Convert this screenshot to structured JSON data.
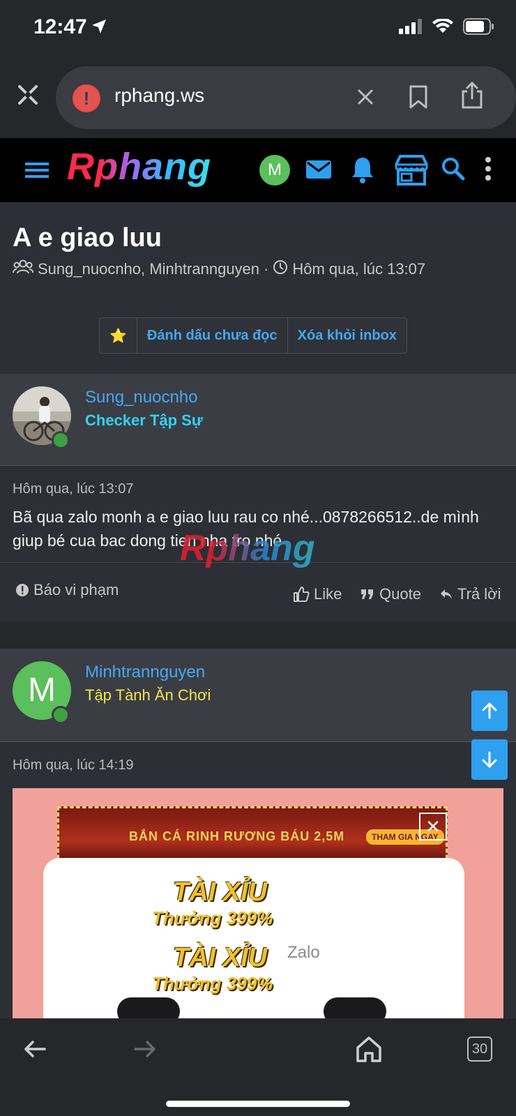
{
  "status_bar": {
    "time": "12:47"
  },
  "browser": {
    "url": "rphang.ws",
    "tabs_count": "30"
  },
  "site": {
    "logo_text": "Rphang",
    "avatar_letter": "M"
  },
  "conversation": {
    "title": "A e giao luu",
    "participants": "Sung_nuocnho, Minhtrannguyen",
    "separator": "·",
    "time": "Hôm qua, lúc 13:07",
    "buttons": {
      "star": "⭐",
      "mark_unread": "Đánh dấu chưa đọc",
      "remove_inbox": "Xóa khỏi inbox"
    }
  },
  "messages": [
    {
      "author": "Sung_nuocnho",
      "role": "Checker Tập Sự",
      "role_color": "#34d2f0",
      "time": "Hôm qua, lúc 13:07",
      "text": "Bã qua zalo monh a e giao luu rau co nhé...0878266512..de mình giup bé cua bac dong tien nha tro nhé",
      "actions": {
        "report": "Báo vi phạm",
        "like": "Like",
        "quote": "Quote",
        "reply": "Trả lời"
      }
    },
    {
      "author": "Minhtrannguyen",
      "avatar_letter": "M",
      "role": "Tập Tành Ăn Chơi",
      "role_color": "#f4e64a",
      "time": "Hôm qua, lúc 14:19",
      "attachment": {
        "banner_text": "BẮN CÁ RINH  RƯƠNG BÁU 2,5M",
        "join_text": "THAM GIA NGAY",
        "promo_title": "TÀI XỈU",
        "promo_sub": "Thưởng 399%",
        "zalo_text": "Zalo"
      }
    }
  ],
  "watermark": "Rphang",
  "colors": {
    "accent": "#45a7f0",
    "header_bg": "#000000",
    "page_bg": "#2c2f35",
    "panel_bg": "#3a3d44",
    "online": "#3fa140"
  }
}
